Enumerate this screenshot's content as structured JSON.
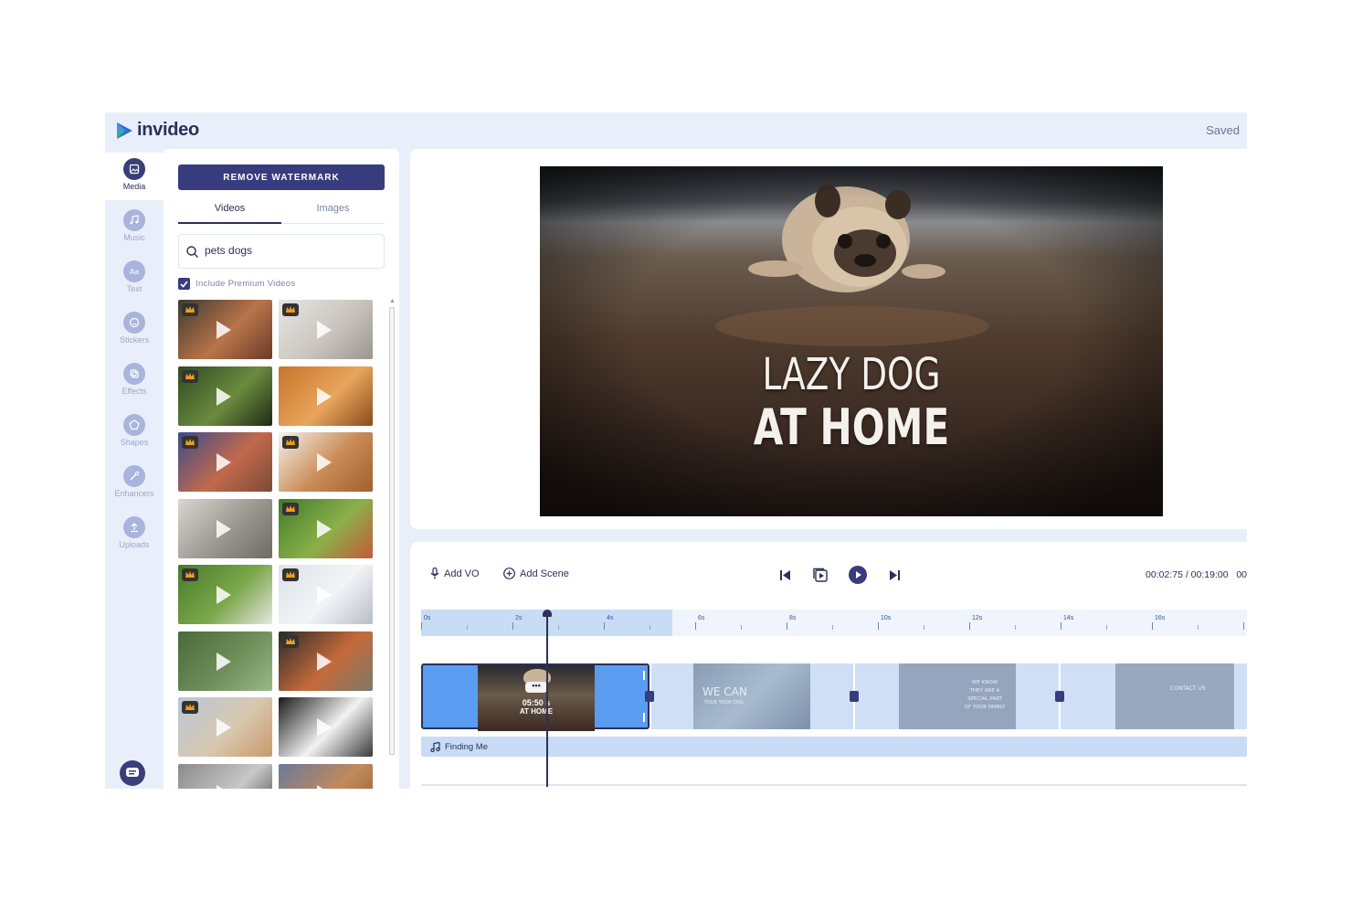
{
  "app": {
    "name": "invideo",
    "status": "Saved"
  },
  "rail": [
    {
      "label": "Media",
      "icon": "image-icon",
      "active": true
    },
    {
      "label": "Music",
      "icon": "music-icon"
    },
    {
      "label": "Text",
      "icon": "text-icon"
    },
    {
      "label": "Stickers",
      "icon": "sticker-icon"
    },
    {
      "label": "Effects",
      "icon": "effects-icon"
    },
    {
      "label": "Shapes",
      "icon": "shape-icon"
    },
    {
      "label": "Enhancers",
      "icon": "wand-icon"
    },
    {
      "label": "Uploads",
      "icon": "upload-icon"
    }
  ],
  "panel": {
    "remove_watermark": "REMOVE WATERMARK",
    "tabs": [
      "Videos",
      "Images"
    ],
    "search_value": "pets dogs",
    "premium_label": "Include Premium Videos",
    "thumbs": [
      {
        "premium": true,
        "colors": [
          "#3d3a30",
          "#b9744a",
          "#6a3a2a"
        ]
      },
      {
        "premium": true,
        "colors": [
          "#e8e6e3",
          "#c9c5be",
          "#9a9690"
        ]
      },
      {
        "premium": true,
        "colors": [
          "#2f4a22",
          "#6b8b3e",
          "#1d2a16"
        ]
      },
      {
        "premium": false,
        "colors": [
          "#c8742a",
          "#e8a55c",
          "#8a4a1c"
        ]
      },
      {
        "premium": true,
        "colors": [
          "#3a4a8c",
          "#c26a4a",
          "#7a4a3a"
        ]
      },
      {
        "premium": true,
        "colors": [
          "#f5f1ec",
          "#c98a55",
          "#a06030"
        ]
      },
      {
        "premium": false,
        "colors": [
          "#d9d6d0",
          "#9a9690",
          "#6e6a64"
        ]
      },
      {
        "premium": true,
        "colors": [
          "#3f7a2a",
          "#8bb04a",
          "#c45a3a"
        ]
      },
      {
        "premium": true,
        "colors": [
          "#4a7a2a",
          "#7aa84a",
          "#e8e6e3"
        ]
      },
      {
        "premium": true,
        "colors": [
          "#dde2e8",
          "#f2f4f6",
          "#b8bec6"
        ]
      },
      {
        "premium": false,
        "colors": [
          "#4a6a3a",
          "#6e8e5a",
          "#9ab88a"
        ]
      },
      {
        "premium": true,
        "colors": [
          "#2a2a2a",
          "#c66a3a",
          "#7a7a6a"
        ]
      },
      {
        "premium": true,
        "colors": [
          "#b8c8d8",
          "#d8c8b0",
          "#c89a6a"
        ]
      },
      {
        "premium": false,
        "colors": [
          "#1a1a1a",
          "#f2f2f2",
          "#3a3a3a"
        ]
      },
      {
        "premium": false,
        "colors": [
          "#8a8a8a",
          "#c8c8c8",
          "#3a3a3a"
        ]
      },
      {
        "premium": false,
        "colors": [
          "#6a7a9a",
          "#c28a5a",
          "#8a5a3a"
        ]
      }
    ]
  },
  "preview": {
    "title_line1": "LAZY DOG",
    "title_line2": "AT HOME"
  },
  "timeline": {
    "add_vo": "Add VO",
    "add_scene": "Add Scene",
    "time": "00:02:75 / 00:19:00",
    "time_extra": "00",
    "ticks": [
      "0s",
      "2s",
      "4s",
      "6s",
      "8s",
      "10s",
      "12s",
      "14s",
      "16s"
    ],
    "scene1_duration": "05:50 s",
    "scene1_caption": "AT HOME",
    "scene2_text": "WE CAN",
    "scene2_sub": "TOUR YOUR DOG",
    "scene3_lines": [
      "WE KNOW",
      "THEY ARE A",
      "SPECIAL PART",
      "OF YOUR FAMILY"
    ],
    "scene4_text": "CONTACT US",
    "audio_track": "Finding Me"
  }
}
